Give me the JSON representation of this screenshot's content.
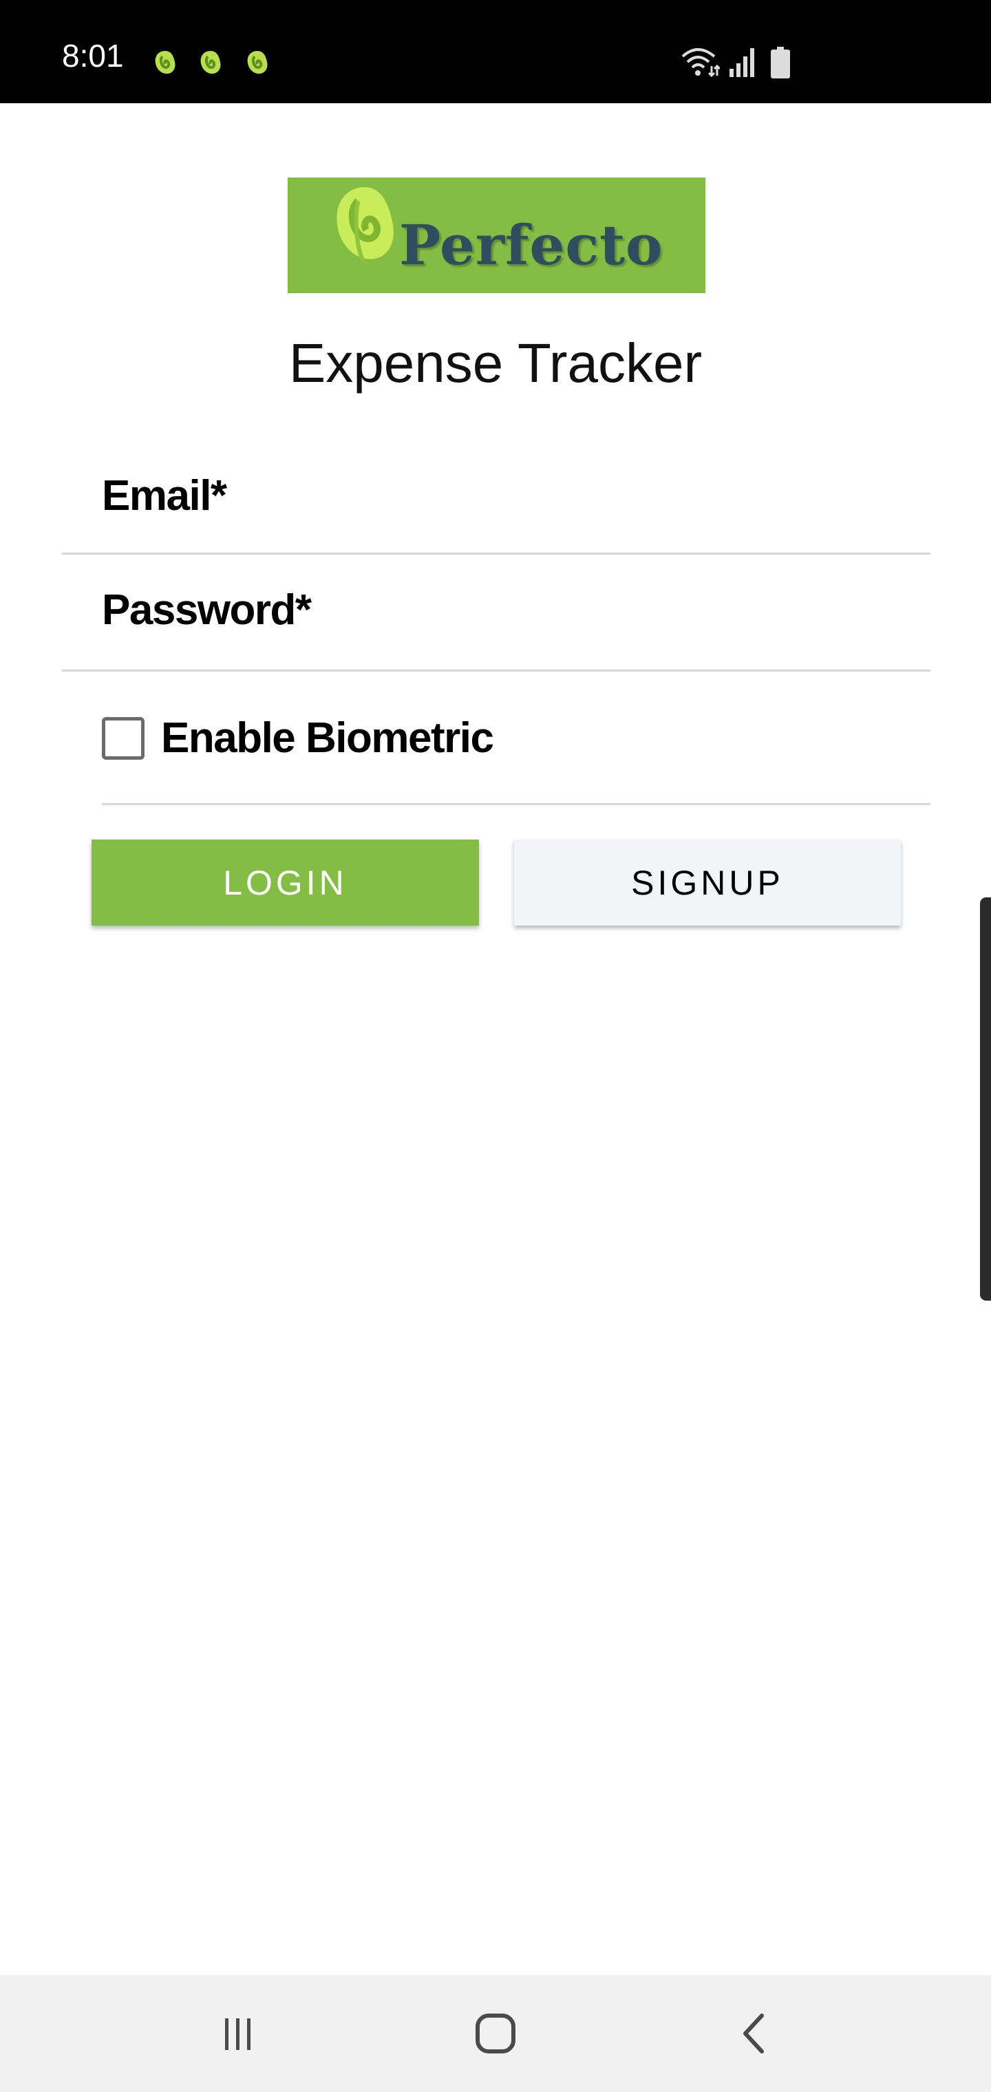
{
  "status_bar": {
    "time": "8:01",
    "notification_icons": [
      "perfecto-leaf-icon",
      "perfecto-leaf-icon",
      "perfecto-leaf-icon"
    ],
    "system_icons": [
      "wifi-icon",
      "signal-icon",
      "battery-icon"
    ]
  },
  "logo": {
    "text": "Perfecto",
    "background_color": "#84bd44",
    "text_color": "#2e4d5e"
  },
  "app_title": "Expense Tracker",
  "form": {
    "email_label": "Email*",
    "email_value": "",
    "password_label": "Password*",
    "password_value": "",
    "biometric_label": "Enable Biometric",
    "biometric_checked": false
  },
  "buttons": {
    "login_label": "LOGIN",
    "signup_label": "SIGNUP",
    "login_color": "#84bd44",
    "signup_color": "#f3f4f8"
  },
  "nav_bar": {
    "icons": [
      "recent-apps-icon",
      "home-icon",
      "back-icon"
    ]
  }
}
